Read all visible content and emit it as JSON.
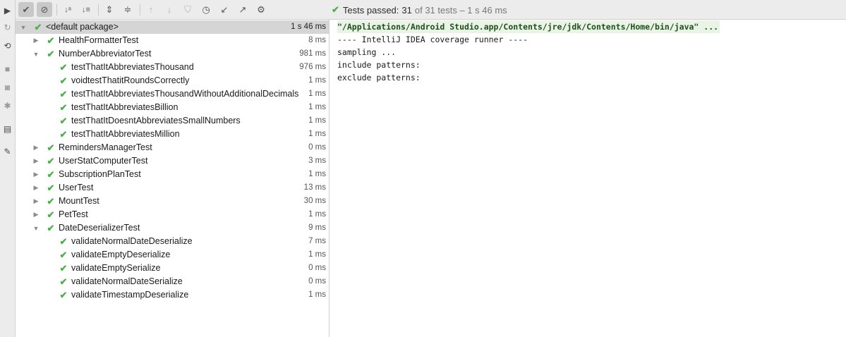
{
  "left_strip": {
    "buttons": [
      {
        "icon": "rerun-with-coverage-icon"
      },
      {
        "icon": "rerun-failed-icon"
      },
      {
        "icon": "toggle-auto-test-icon"
      },
      {
        "icon": "stop-icon"
      },
      {
        "icon": "dump-threads-icon"
      },
      {
        "icon": "debug-icon"
      },
      {
        "icon": "layout-icon"
      },
      {
        "icon": "pin-icon"
      }
    ]
  },
  "toolbar": {
    "buttons": [
      {
        "icon": "show-passed-icon"
      },
      {
        "icon": "show-ignored-icon"
      },
      {
        "icon": "sort-alphabetically-icon"
      },
      {
        "icon": "sort-by-duration-icon"
      },
      {
        "icon": "expand-all-icon"
      },
      {
        "icon": "collapse-all-icon"
      },
      {
        "icon": "previous-failed-icon"
      },
      {
        "icon": "next-failed-icon"
      },
      {
        "icon": "shield-icon"
      },
      {
        "icon": "history-icon"
      },
      {
        "icon": "import-tests-icon"
      },
      {
        "icon": "export-tests-icon"
      },
      {
        "icon": "settings-gear-icon"
      }
    ]
  },
  "status": {
    "prefix": "Tests passed:",
    "passed": "31",
    "detail": "of 31 tests – 1 s 46 ms"
  },
  "tree": {
    "rows": [
      {
        "name": "<default package>",
        "time": "1 s 46 ms",
        "level": 0,
        "expander": "expanded",
        "selected": true
      },
      {
        "name": "HealthFormatterTest",
        "time": "8 ms",
        "level": 1,
        "expander": "collapsed"
      },
      {
        "name": "NumberAbbreviatorTest",
        "time": "981 ms",
        "level": 1,
        "expander": "expanded"
      },
      {
        "name": "testThatItAbbreviatesThousand",
        "time": "976 ms",
        "level": 2,
        "expander": "none"
      },
      {
        "name": "voidtestThatitRoundsCorrectly",
        "time": "1 ms",
        "level": 2,
        "expander": "none"
      },
      {
        "name": "testThatItAbbreviatesThousandWithoutAdditionalDecimals",
        "time": "1 ms",
        "level": 2,
        "expander": "none"
      },
      {
        "name": "testThatItAbbreviatesBillion",
        "time": "1 ms",
        "level": 2,
        "expander": "none"
      },
      {
        "name": "testThatItDoesntAbbreviatesSmallNumbers",
        "time": "1 ms",
        "level": 2,
        "expander": "none"
      },
      {
        "name": "testThatItAbbreviatesMillion",
        "time": "1 ms",
        "level": 2,
        "expander": "none"
      },
      {
        "name": "RemindersManagerTest",
        "time": "0 ms",
        "level": 1,
        "expander": "collapsed"
      },
      {
        "name": "UserStatComputerTest",
        "time": "3 ms",
        "level": 1,
        "expander": "collapsed"
      },
      {
        "name": "SubscriptionPlanTest",
        "time": "1 ms",
        "level": 1,
        "expander": "collapsed"
      },
      {
        "name": "UserTest",
        "time": "13 ms",
        "level": 1,
        "expander": "collapsed"
      },
      {
        "name": "MountTest",
        "time": "30 ms",
        "level": 1,
        "expander": "collapsed"
      },
      {
        "name": "PetTest",
        "time": "1 ms",
        "level": 1,
        "expander": "collapsed"
      },
      {
        "name": "DateDeserializerTest",
        "time": "9 ms",
        "level": 1,
        "expander": "expanded"
      },
      {
        "name": "validateNormalDateDeserialize",
        "time": "7 ms",
        "level": 2,
        "expander": "none"
      },
      {
        "name": "validateEmptyDeserialize",
        "time": "1 ms",
        "level": 2,
        "expander": "none"
      },
      {
        "name": "validateEmptySerialize",
        "time": "0 ms",
        "level": 2,
        "expander": "none"
      },
      {
        "name": "validateNormalDateSerialize",
        "time": "0 ms",
        "level": 2,
        "expander": "none"
      },
      {
        "name": "validateTimestampDeserialize",
        "time": "1 ms",
        "level": 2,
        "expander": "none"
      }
    ]
  },
  "console": {
    "lines": [
      {
        "text": "\"/Applications/Android Studio.app/Contents/jre/jdk/Contents/Home/bin/java\" ...",
        "kind": "cmd"
      },
      {
        "text": "---- IntelliJ IDEA coverage runner ----",
        "kind": "out"
      },
      {
        "text": "sampling ...",
        "kind": "out"
      },
      {
        "text": "include patterns:",
        "kind": "out"
      },
      {
        "text": "exclude patterns:",
        "kind": "out"
      }
    ]
  },
  "colors": {
    "pass_green": "#4eb04b",
    "toolbar_bg": "#ececec",
    "selection_bg": "#d5d5d5",
    "command_bg": "#eaf4e6"
  }
}
